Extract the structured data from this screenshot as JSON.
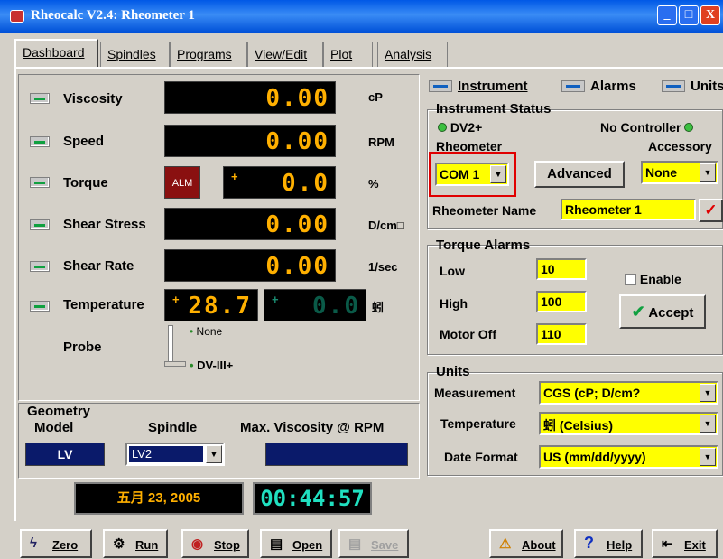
{
  "window": {
    "title": "Rheocalc V2.4: Rheometer 1",
    "minimize": "_",
    "maximize": "□",
    "close": "X"
  },
  "tabs": [
    "Dashboard",
    "Spindles",
    "Programs",
    "View/Edit",
    "Plot",
    "Analysis"
  ],
  "readings": [
    {
      "label": "Viscosity",
      "value": "0.00",
      "unit": "cP"
    },
    {
      "label": "Speed",
      "value": "0.00",
      "unit": "RPM"
    },
    {
      "label": "Torque",
      "value": "0.0",
      "unit": "%",
      "alarm": "ALM",
      "sign": "+"
    },
    {
      "label": "Shear Stress",
      "value": "0.00",
      "unit": "D/cm□"
    },
    {
      "label": "Shear Rate",
      "value": "0.00",
      "unit": "1/sec"
    },
    {
      "label": "Temperature",
      "value": "28.7",
      "value2": "0.0",
      "unit": "蚓",
      "sign": "+"
    }
  ],
  "probe": {
    "label": "Probe",
    "opt1": "None",
    "opt2": "DV-III+"
  },
  "geometry": {
    "title": "Geometry",
    "model_label": "Model",
    "model_value": "LV",
    "spindle_label": "Spindle",
    "spindle_value": "LV2",
    "maxvisc_label": "Max. Viscosity @ RPM"
  },
  "clock": {
    "date": "五月 23, 2005",
    "time": "00:44:57"
  },
  "toggles": {
    "instrument": "Instrument",
    "alarms": "Alarms",
    "units": "Units"
  },
  "instrument_status": {
    "title": "Instrument Status",
    "device": "DV2+",
    "controller": "No Controller",
    "rheometer_label": "Rheometer",
    "port": "COM 1",
    "advanced": "Advanced",
    "accessory_label": "Accessory",
    "accessory": "None",
    "name_label": "Rheometer Name",
    "name_value": "Rheometer 1",
    "check": "✓"
  },
  "torque_alarms": {
    "title": "Torque Alarms",
    "low_label": "Low",
    "low": "10",
    "high_label": "High",
    "high": "100",
    "motor_label": "Motor Off",
    "motor": "110",
    "enable": "Enable",
    "accept": "Accept"
  },
  "units": {
    "title": "Units",
    "measurement_label": "Measurement",
    "measurement": "CGS (cP; D/cm?",
    "temperature_label": "Temperature",
    "temperature": "蚓 (Celsius)",
    "date_label": "Date Format",
    "date": "US (mm/dd/yyyy)"
  },
  "toolbar": {
    "zero": "Zero",
    "run": "Run",
    "stop": "Stop",
    "open": "Open",
    "save": "Save",
    "about": "About",
    "help": "Help",
    "exit": "Exit"
  },
  "colors": {
    "title_bar": "#0058e6",
    "field": "#ffff00",
    "digit": "#ffb000",
    "highlight": "#e00000"
  }
}
